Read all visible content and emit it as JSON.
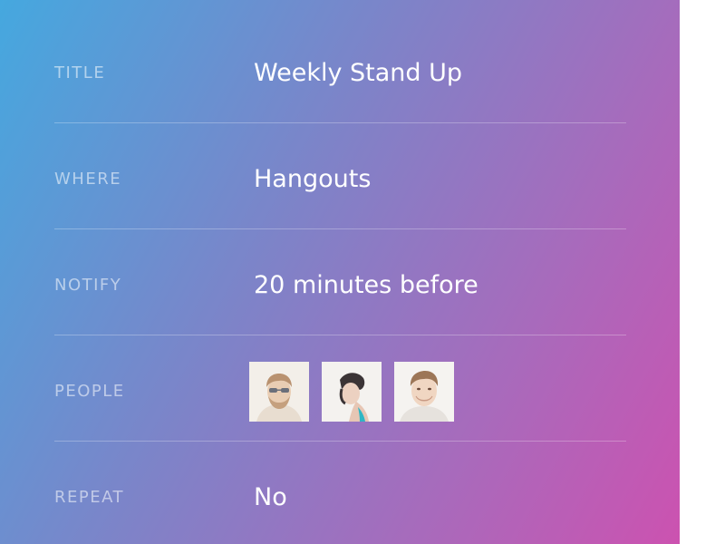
{
  "fields": {
    "title": {
      "label": "TITLE",
      "value": "Weekly Stand Up"
    },
    "where": {
      "label": "WHERE",
      "value": "Hangouts"
    },
    "notify": {
      "label": "NOTIFY",
      "value": "20 minutes before"
    },
    "people": {
      "label": "PEOPLE",
      "avatars": [
        {
          "icon": "avatar-man-sunglasses"
        },
        {
          "icon": "avatar-woman-side-profile"
        },
        {
          "icon": "avatar-man-smiling"
        }
      ]
    },
    "repeat": {
      "label": "REPEAT",
      "value": "No"
    }
  },
  "colors": {
    "gradient_start": "#45a8df",
    "gradient_mid": "#7e83c8",
    "gradient_end": "#cc52b0"
  }
}
